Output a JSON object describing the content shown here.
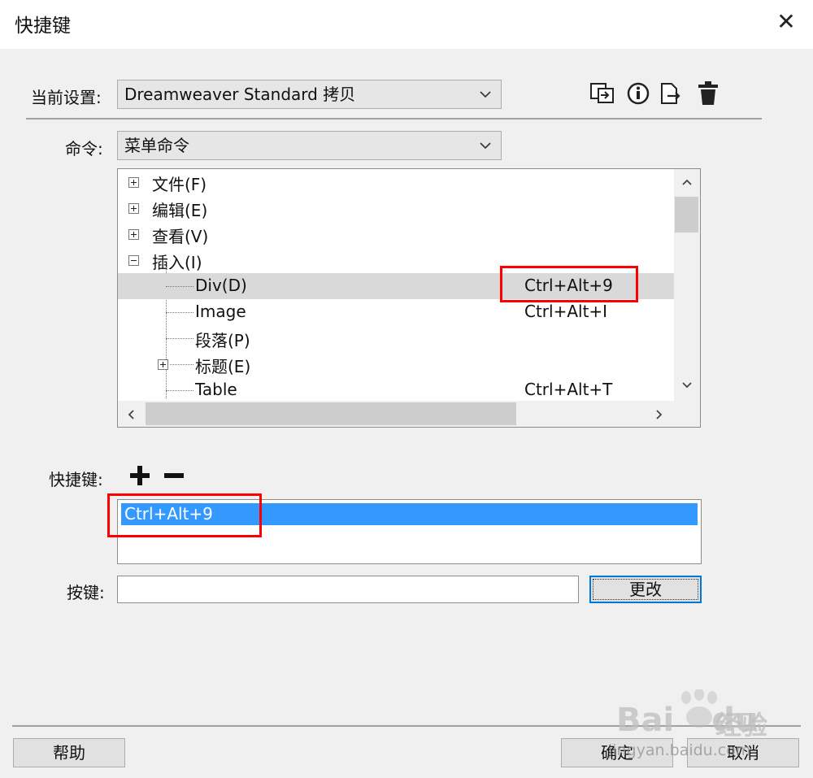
{
  "window": {
    "title": "快捷键",
    "close_icon": "close-icon"
  },
  "preset": {
    "label": "当前设置:",
    "value": "Dreamweaver Standard 拷贝"
  },
  "toolbar": {
    "icons": [
      "duplicate-set-icon",
      "info-icon",
      "export-icon",
      "delete-icon"
    ]
  },
  "commands": {
    "label": "命令:",
    "value": "菜单命令"
  },
  "tree": {
    "items": [
      {
        "label": "文件(F)",
        "shortcut": "",
        "level": 0,
        "expander": "plus"
      },
      {
        "label": "编辑(E)",
        "shortcut": "",
        "level": 0,
        "expander": "plus"
      },
      {
        "label": "查看(V)",
        "shortcut": "",
        "level": 0,
        "expander": "plus"
      },
      {
        "label": "插入(I)",
        "shortcut": "",
        "level": 0,
        "expander": "minus"
      },
      {
        "label": "Div(D)",
        "shortcut": "Ctrl+Alt+9",
        "level": 1,
        "expander": "none",
        "selected": true
      },
      {
        "label": "Image",
        "shortcut": "Ctrl+Alt+I",
        "level": 1,
        "expander": "none"
      },
      {
        "label": "段落(P)",
        "shortcut": "",
        "level": 1,
        "expander": "none"
      },
      {
        "label": "标题(E)",
        "shortcut": "",
        "level": 1,
        "expander": "plus"
      },
      {
        "label": "Table",
        "shortcut": "Ctrl+Alt+T",
        "level": 1,
        "expander": "none"
      }
    ]
  },
  "shortcuts": {
    "label": "快捷键:",
    "add_icon": "plus-icon",
    "remove_icon": "minus-icon",
    "items": [
      "Ctrl+Alt+9"
    ]
  },
  "keypress": {
    "label": "按键:",
    "value": "",
    "change_label": "更改"
  },
  "footer": {
    "help_label": "帮助",
    "ok_label": "确定",
    "cancel_label": "取消"
  },
  "watermark": {
    "brand": "Bai",
    "brand2": "du",
    "cn": "经验",
    "url": "jingyan.baidu.com"
  },
  "colors": {
    "highlight": "#ff0000",
    "selection": "#3399ff"
  }
}
